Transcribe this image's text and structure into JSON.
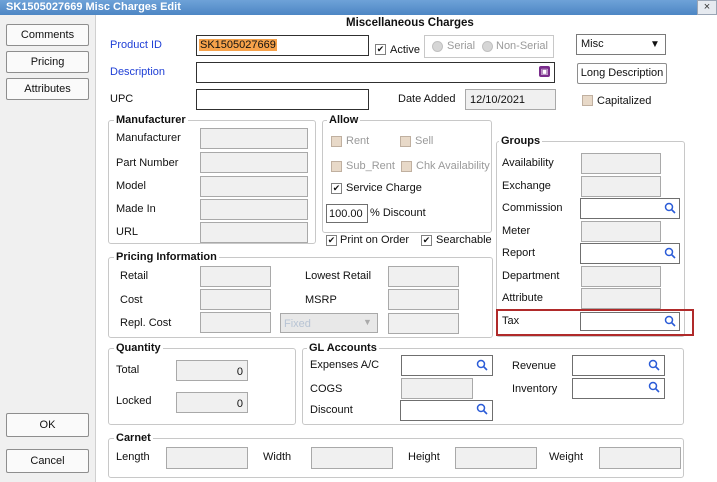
{
  "window": {
    "title": "SK1505027669 Misc Charges Edit",
    "close_icon": "×"
  },
  "sidebar": {
    "comments": "Comments",
    "pricing": "Pricing",
    "attributes": "Attributes",
    "ok": "OK",
    "cancel": "Cancel"
  },
  "form": {
    "heading": "Miscellaneous Charges",
    "product_id_label": "Product ID",
    "product_id_value": "SK1505027669",
    "active_label": "Active",
    "serial_label": "Serial",
    "non_serial_label": "Non-Serial",
    "type_value": "Misc",
    "description_label": "Description",
    "long_description_button": "Long Description",
    "upc_label": "UPC",
    "date_added_label": "Date Added",
    "date_added_value": "12/10/2021",
    "capitalized_label": "Capitalized"
  },
  "manufacturer": {
    "title": "Manufacturer",
    "manufacturer_label": "Manufacturer",
    "part_number_label": "Part Number",
    "model_label": "Model",
    "made_in_label": "Made In",
    "url_label": "URL"
  },
  "allow": {
    "title": "Allow",
    "rent": "Rent",
    "sell": "Sell",
    "sub_rent": "Sub_Rent",
    "chk_availability": "Chk Availability",
    "service_charge": "Service Charge",
    "discount_value": "100.00",
    "discount_label": "% Discount",
    "print_on_order": "Print on Order",
    "searchable": "Searchable"
  },
  "groups": {
    "title": "Groups",
    "availability": "Availability",
    "exchange": "Exchange",
    "commission": "Commission",
    "meter": "Meter",
    "report": "Report",
    "department": "Department",
    "attribute": "Attribute",
    "tax": "Tax"
  },
  "pricing": {
    "title": "Pricing Information",
    "retail": "Retail",
    "cost": "Cost",
    "repl_cost": "Repl. Cost",
    "lowest_retail": "Lowest Retail",
    "msrp": "MSRP",
    "fixed": "Fixed"
  },
  "quantity": {
    "title": "Quantity",
    "total_label": "Total",
    "total_value": "0",
    "locked_label": "Locked",
    "locked_value": "0"
  },
  "gl": {
    "title": "GL Accounts",
    "expenses": "Expenses A/C",
    "cogs": "COGS",
    "discount": "Discount",
    "revenue": "Revenue",
    "inventory": "Inventory"
  },
  "carnet": {
    "title": "Carnet",
    "length": "Length",
    "width": "Width",
    "height": "Height",
    "weight": "Weight"
  },
  "colors": {
    "product_id_bg": "#f7a24a",
    "highlight_border": "#b02a2a",
    "label_blue": "#1f3fd6"
  }
}
